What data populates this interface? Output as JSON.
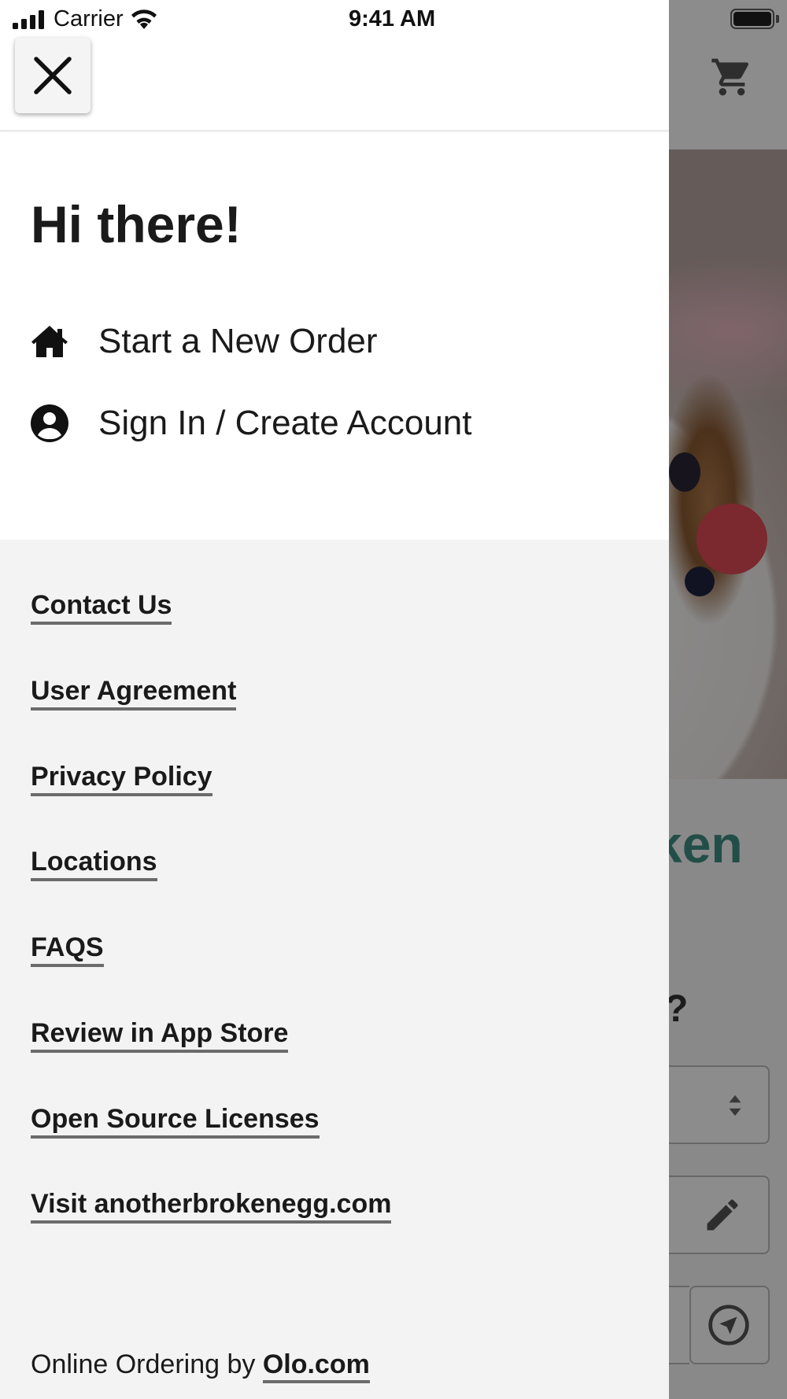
{
  "status_bar": {
    "carrier": "Carrier",
    "time": "9:41 AM"
  },
  "background": {
    "title_fragment": "ken",
    "question_fragment": "?",
    "icons": [
      "cart-icon",
      "sort-arrows-icon",
      "pencil-icon",
      "location-arrow-icon"
    ]
  },
  "drawer": {
    "close_icon": "close-icon",
    "greeting": "Hi there!",
    "menu": [
      {
        "label": "Start a New Order",
        "icon": "home-icon"
      },
      {
        "label": "Sign In / Create Account",
        "icon": "user-circle-icon"
      }
    ],
    "links": [
      "Contact Us",
      "User Agreement",
      "Privacy Policy",
      "Locations",
      "FAQS",
      "Review in App Store",
      "Open Source Licenses",
      "Visit anotherbrokenegg.com"
    ],
    "footer": {
      "prefix": "Online Ordering by ",
      "link": "Olo.com"
    }
  },
  "colors": {
    "drawer_background": "#f3f3f3",
    "accent_title": "#3f8f83",
    "link_underline": "#6b6b6b"
  }
}
